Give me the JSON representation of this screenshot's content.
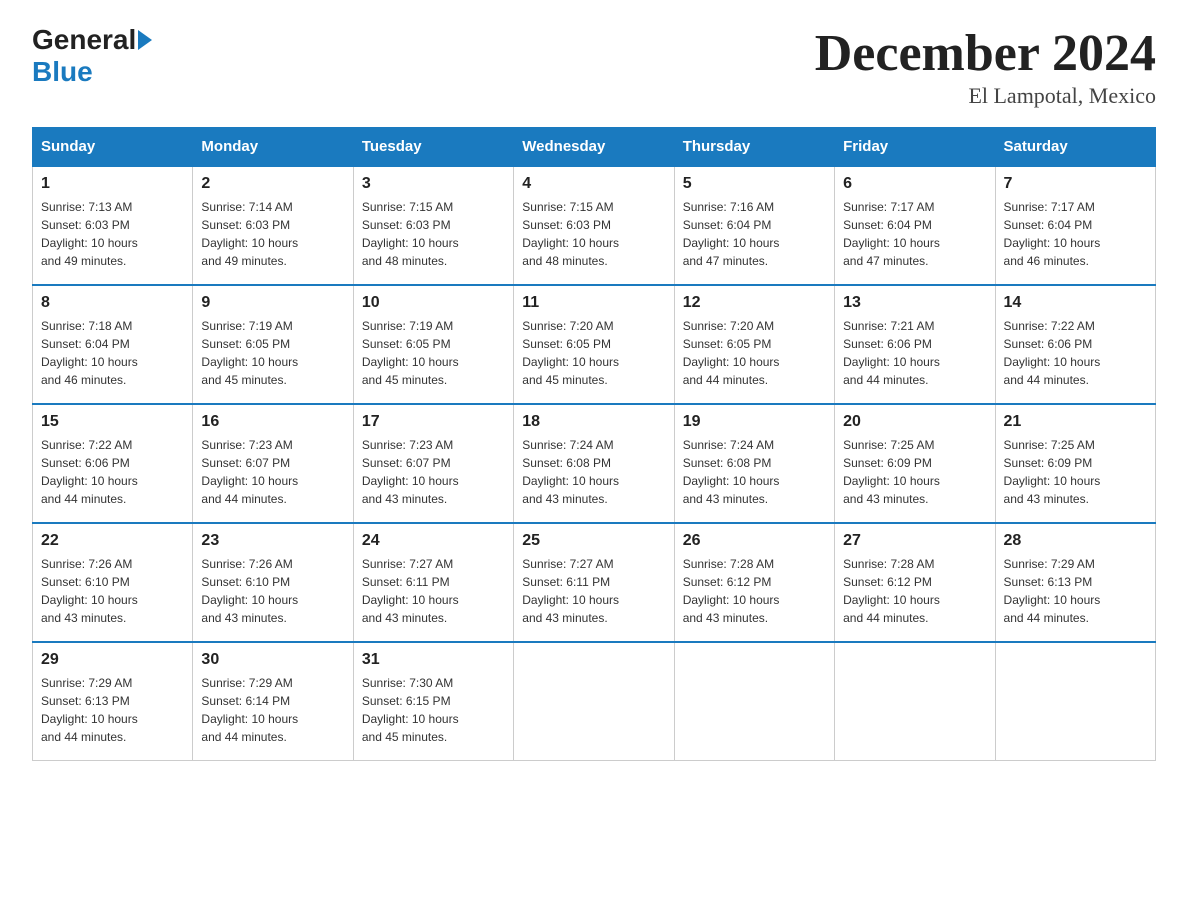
{
  "header": {
    "logo_general": "General",
    "logo_blue": "Blue",
    "title": "December 2024",
    "subtitle": "El Lampotal, Mexico"
  },
  "days_of_week": [
    "Sunday",
    "Monday",
    "Tuesday",
    "Wednesday",
    "Thursday",
    "Friday",
    "Saturday"
  ],
  "weeks": [
    [
      {
        "day": "1",
        "sunrise": "7:13 AM",
        "sunset": "6:03 PM",
        "daylight": "10 hours and 49 minutes."
      },
      {
        "day": "2",
        "sunrise": "7:14 AM",
        "sunset": "6:03 PM",
        "daylight": "10 hours and 49 minutes."
      },
      {
        "day": "3",
        "sunrise": "7:15 AM",
        "sunset": "6:03 PM",
        "daylight": "10 hours and 48 minutes."
      },
      {
        "day": "4",
        "sunrise": "7:15 AM",
        "sunset": "6:03 PM",
        "daylight": "10 hours and 48 minutes."
      },
      {
        "day": "5",
        "sunrise": "7:16 AM",
        "sunset": "6:04 PM",
        "daylight": "10 hours and 47 minutes."
      },
      {
        "day": "6",
        "sunrise": "7:17 AM",
        "sunset": "6:04 PM",
        "daylight": "10 hours and 47 minutes."
      },
      {
        "day": "7",
        "sunrise": "7:17 AM",
        "sunset": "6:04 PM",
        "daylight": "10 hours and 46 minutes."
      }
    ],
    [
      {
        "day": "8",
        "sunrise": "7:18 AM",
        "sunset": "6:04 PM",
        "daylight": "10 hours and 46 minutes."
      },
      {
        "day": "9",
        "sunrise": "7:19 AM",
        "sunset": "6:05 PM",
        "daylight": "10 hours and 45 minutes."
      },
      {
        "day": "10",
        "sunrise": "7:19 AM",
        "sunset": "6:05 PM",
        "daylight": "10 hours and 45 minutes."
      },
      {
        "day": "11",
        "sunrise": "7:20 AM",
        "sunset": "6:05 PM",
        "daylight": "10 hours and 45 minutes."
      },
      {
        "day": "12",
        "sunrise": "7:20 AM",
        "sunset": "6:05 PM",
        "daylight": "10 hours and 44 minutes."
      },
      {
        "day": "13",
        "sunrise": "7:21 AM",
        "sunset": "6:06 PM",
        "daylight": "10 hours and 44 minutes."
      },
      {
        "day": "14",
        "sunrise": "7:22 AM",
        "sunset": "6:06 PM",
        "daylight": "10 hours and 44 minutes."
      }
    ],
    [
      {
        "day": "15",
        "sunrise": "7:22 AM",
        "sunset": "6:06 PM",
        "daylight": "10 hours and 44 minutes."
      },
      {
        "day": "16",
        "sunrise": "7:23 AM",
        "sunset": "6:07 PM",
        "daylight": "10 hours and 44 minutes."
      },
      {
        "day": "17",
        "sunrise": "7:23 AM",
        "sunset": "6:07 PM",
        "daylight": "10 hours and 43 minutes."
      },
      {
        "day": "18",
        "sunrise": "7:24 AM",
        "sunset": "6:08 PM",
        "daylight": "10 hours and 43 minutes."
      },
      {
        "day": "19",
        "sunrise": "7:24 AM",
        "sunset": "6:08 PM",
        "daylight": "10 hours and 43 minutes."
      },
      {
        "day": "20",
        "sunrise": "7:25 AM",
        "sunset": "6:09 PM",
        "daylight": "10 hours and 43 minutes."
      },
      {
        "day": "21",
        "sunrise": "7:25 AM",
        "sunset": "6:09 PM",
        "daylight": "10 hours and 43 minutes."
      }
    ],
    [
      {
        "day": "22",
        "sunrise": "7:26 AM",
        "sunset": "6:10 PM",
        "daylight": "10 hours and 43 minutes."
      },
      {
        "day": "23",
        "sunrise": "7:26 AM",
        "sunset": "6:10 PM",
        "daylight": "10 hours and 43 minutes."
      },
      {
        "day": "24",
        "sunrise": "7:27 AM",
        "sunset": "6:11 PM",
        "daylight": "10 hours and 43 minutes."
      },
      {
        "day": "25",
        "sunrise": "7:27 AM",
        "sunset": "6:11 PM",
        "daylight": "10 hours and 43 minutes."
      },
      {
        "day": "26",
        "sunrise": "7:28 AM",
        "sunset": "6:12 PM",
        "daylight": "10 hours and 43 minutes."
      },
      {
        "day": "27",
        "sunrise": "7:28 AM",
        "sunset": "6:12 PM",
        "daylight": "10 hours and 44 minutes."
      },
      {
        "day": "28",
        "sunrise": "7:29 AM",
        "sunset": "6:13 PM",
        "daylight": "10 hours and 44 minutes."
      }
    ],
    [
      {
        "day": "29",
        "sunrise": "7:29 AM",
        "sunset": "6:13 PM",
        "daylight": "10 hours and 44 minutes."
      },
      {
        "day": "30",
        "sunrise": "7:29 AM",
        "sunset": "6:14 PM",
        "daylight": "10 hours and 44 minutes."
      },
      {
        "day": "31",
        "sunrise": "7:30 AM",
        "sunset": "6:15 PM",
        "daylight": "10 hours and 45 minutes."
      },
      null,
      null,
      null,
      null
    ]
  ],
  "labels": {
    "sunrise": "Sunrise:",
    "sunset": "Sunset:",
    "daylight": "Daylight:"
  }
}
